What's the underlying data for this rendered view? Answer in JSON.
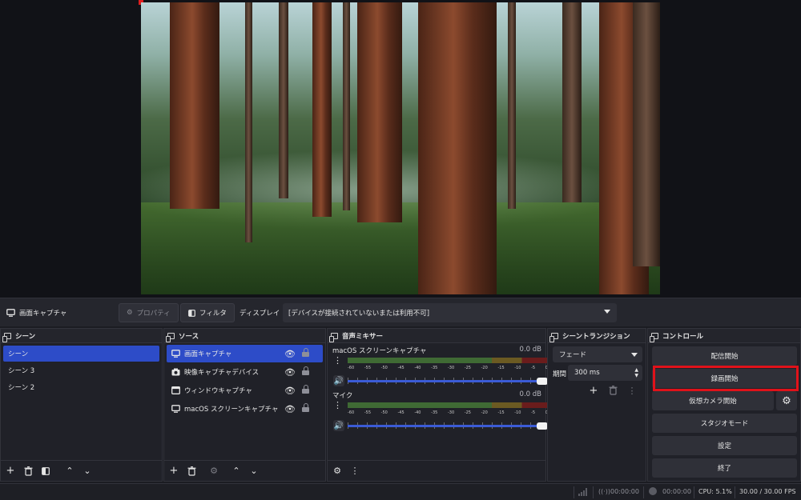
{
  "toolbar": {
    "source_name": "画面キャプチャ",
    "properties_label": "プロパティ",
    "filters_label": "フィルタ",
    "display_label": "ディスプレイ",
    "display_value": "[デバイスが接続されていないまたは利用不可]"
  },
  "scenes": {
    "title": "シーン",
    "items": [
      "シーン",
      "シーン 3",
      "シーン 2"
    ],
    "selected": "シーン"
  },
  "sources": {
    "title": "ソース",
    "items": [
      {
        "label": "画面キャプチャ",
        "icon": "monitor-icon"
      },
      {
        "label": "映像キャプチャデバイス",
        "icon": "camera-icon"
      },
      {
        "label": "ウィンドウキャプチャ",
        "icon": "window-icon"
      },
      {
        "label": "macOS スクリーンキャプチャ",
        "icon": "monitor-icon"
      }
    ]
  },
  "mixer": {
    "title": "音声ミキサー",
    "channels": [
      {
        "name": "macOS スクリーンキャプチャ",
        "level": "0.0 dB",
        "volume": 1.0
      },
      {
        "name": "マイク",
        "level": "0.0 dB",
        "volume": 1.0
      }
    ],
    "scale": [
      "-60",
      "-55",
      "-50",
      "-45",
      "-40",
      "-35",
      "-30",
      "-25",
      "-20",
      "-15",
      "-10",
      "-5",
      "0"
    ]
  },
  "transitions": {
    "title": "シーントランジション",
    "selected": "フェード",
    "duration_label": "期間",
    "duration_value": "300 ms"
  },
  "controls": {
    "title": "コントロール",
    "stream": "配信開始",
    "record": "録画開始",
    "virtual_cam": "仮想カメラ開始",
    "studio": "スタジオモード",
    "settings": "設定",
    "exit": "終了"
  },
  "status": {
    "stream_time": "00:00:00",
    "record_time": "00:00:00",
    "cpu": "CPU: 5.1%",
    "fps": "30.00 / 30.00 FPS"
  },
  "colors": {
    "selected": "#2d4cc8",
    "highlight": "#e0121a"
  }
}
